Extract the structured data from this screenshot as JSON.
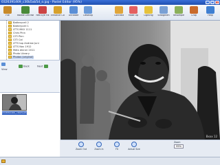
{
  "window": {
    "title": "0326391469_c30b5ab5d_o.jpg - Pastel Editor (95%)",
    "minimize": "_",
    "maximize": "□",
    "close": "×"
  },
  "toolbar": {
    "items": [
      {
        "label": "File",
        "icon": "file-icon",
        "color": "#c88a2a"
      },
      {
        "label": "Rotate Left Rotate Right",
        "icon": "rotate-icon",
        "color": "#4a8a3a"
      },
      {
        "label": "Red Eye Fix",
        "icon": "red-eye-icon",
        "color": "#c44"
      },
      {
        "label": "Enhance Colors",
        "icon": "enhance-icon",
        "color": "#d7a12c"
      },
      {
        "label": "Unrotate",
        "icon": "unrotate-icon",
        "color": "#5b8fd6"
      },
      {
        "label": "Desktop",
        "icon": "desktop-icon",
        "color": "#6a9ad8"
      },
      {
        "label": "Contrast",
        "icon": "contrast-icon",
        "color": "#e0a53a"
      },
      {
        "label": "Make Up",
        "icon": "makeup-icon",
        "color": "#e46060"
      },
      {
        "label": "Lighting",
        "icon": "lighting-icon",
        "color": "#e6c23c"
      },
      {
        "label": "Straighten",
        "icon": "straighten-icon",
        "color": "#7aa0d4"
      },
      {
        "label": "Resample",
        "icon": "resample-icon",
        "color": "#8bb05a"
      },
      {
        "label": "Crop",
        "icon": "crop-icon",
        "color": "#c96a2b"
      },
      {
        "label": "Help",
        "icon": "help-icon",
        "color": "#3f7fd1"
      }
    ]
  },
  "folder_tree": {
    "items": [
      "Batterycell 2",
      "Batterycell 1",
      "LTTS MKV 1111",
      "Chris Pinn",
      "CITI Pinn",
      "CITI Cal",
      "LTTS top Andrew Juni",
      "LTTS Nov 1912",
      "Mets dinner 2011",
      "Photo Library",
      "Photos (original)"
    ],
    "selected_index": 10
  },
  "nav": {
    "view_label": "View",
    "back_label": "Back",
    "next_label": "Next"
  },
  "thumbnails": {
    "items": [
      {
        "caption": "0326391469_c30b5ab5d..."
      }
    ]
  },
  "canvas": {
    "watermark": "Bxxx 12"
  },
  "zoombar": {
    "buttons": [
      {
        "label": "Zoom Out",
        "icon": "zoom-out-icon"
      },
      {
        "label": "Zoom In",
        "icon": "zoom-in-icon"
      },
      {
        "label": "Fit",
        "icon": "fit-icon"
      },
      {
        "label": "Actual Size",
        "icon": "actual-size-icon"
      }
    ],
    "zoom_label": "Zoom",
    "zoom_value": "95%"
  },
  "statusbar": {
    "text": ""
  }
}
